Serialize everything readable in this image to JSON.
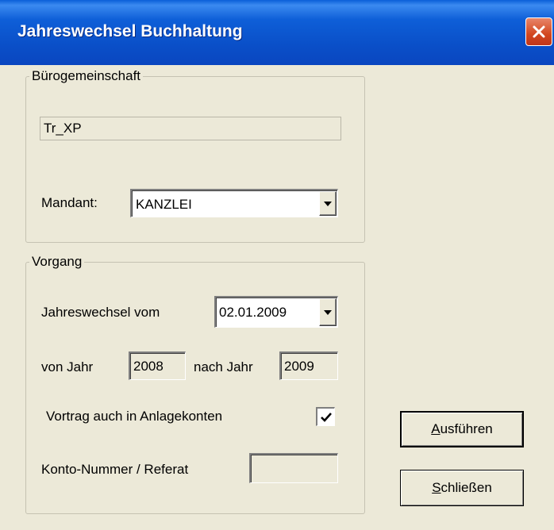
{
  "window": {
    "title": "Jahreswechsel Buchhaltung",
    "close_icon": "close-icon"
  },
  "buerogemeinschaft": {
    "legend": "Bürogemeinschaft",
    "name_value": "Tr_XP",
    "mandant_label": "Mandant:",
    "mandant_value": "KANZLEI"
  },
  "vorgang": {
    "legend": "Vorgang",
    "jahreswechsel_label": "Jahreswechsel vom",
    "jahreswechsel_date": "02.01.2009",
    "von_jahr_label": "von Jahr",
    "von_jahr_value": "2008",
    "nach_jahr_label": "nach Jahr",
    "nach_jahr_value": "2009",
    "vortrag_label": "Vortrag auch in Anlagekonten",
    "vortrag_checked": true,
    "konto_label": "Konto-Nummer / Referat",
    "konto_value": ""
  },
  "buttons": {
    "ausfuehren_mnemonic": "A",
    "ausfuehren_rest": "usführen",
    "schliessen_mnemonic": "S",
    "schliessen_rest": "chließen"
  }
}
